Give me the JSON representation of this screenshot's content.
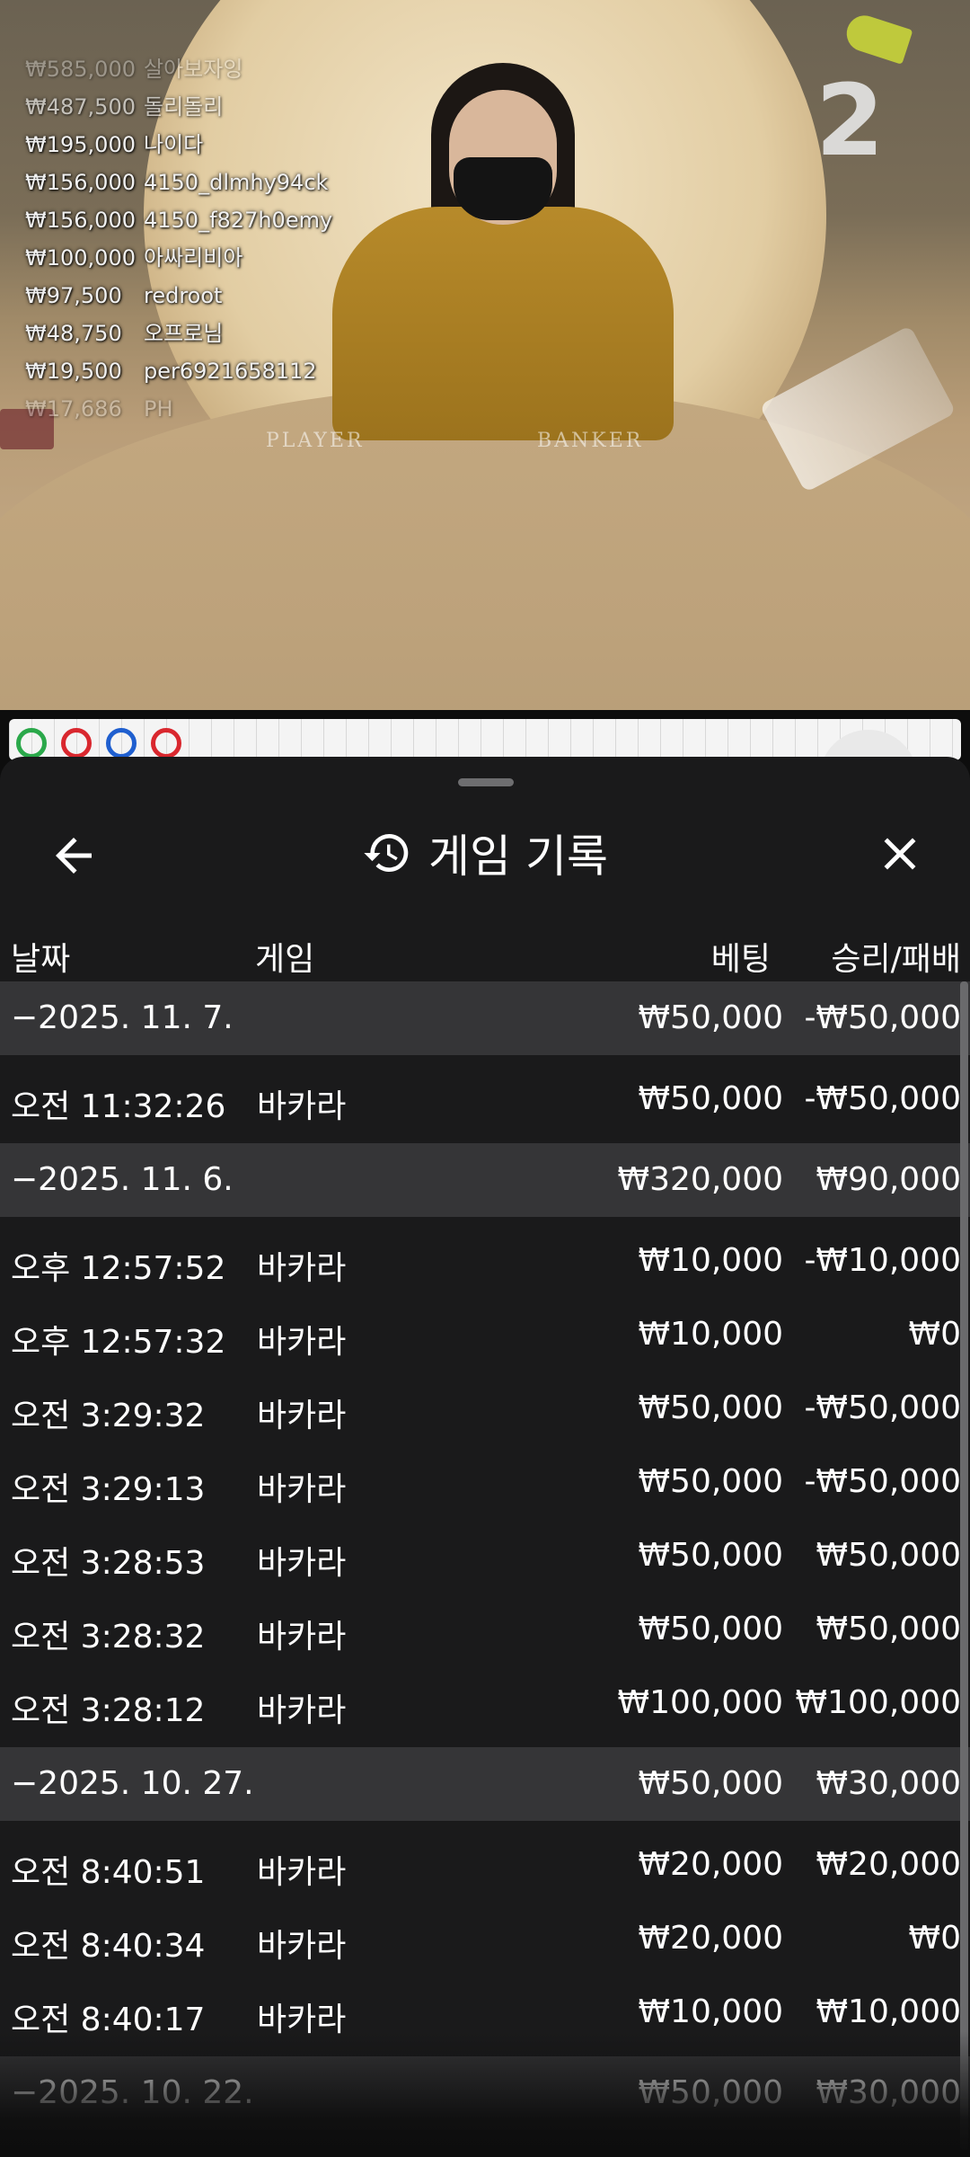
{
  "stream": {
    "round_number": "2",
    "table_labels": {
      "player": "PLAYER",
      "banker": "BANKER"
    },
    "winners": [
      {
        "amount": "₩585,000",
        "name": "살아보자잉",
        "style": "faded"
      },
      {
        "amount": "₩487,500",
        "name": "돌리돌리",
        "style": "dim"
      },
      {
        "amount": "₩195,000",
        "name": "나이다",
        "style": ""
      },
      {
        "amount": "₩156,000",
        "name": "4150_dlmhy94ck",
        "style": ""
      },
      {
        "amount": "₩156,000",
        "name": "4150_f827h0emy",
        "style": ""
      },
      {
        "amount": "₩100,000",
        "name": "아싸리비아",
        "style": ""
      },
      {
        "amount": "₩97,500",
        "name": "redroot",
        "style": ""
      },
      {
        "amount": "₩48,750",
        "name": "오프로님",
        "style": ""
      },
      {
        "amount": "₩19,500",
        "name": "per6921658112",
        "style": ""
      },
      {
        "amount": "₩17,686",
        "name": "PH",
        "style": "faded"
      }
    ],
    "roadmap_colors": {
      "green": "#2aa84a",
      "red": "#d9272e",
      "blue": "#1f5fcf"
    }
  },
  "sheet": {
    "title": "게임 기록",
    "icons": {
      "back": "arrow-left-icon",
      "history": "history-icon",
      "close": "close-icon"
    },
    "columns": {
      "date": "날짜",
      "game": "게임",
      "bet": "베팅",
      "win_loss": "승리/패배"
    },
    "rows": [
      {
        "type": "group",
        "date": "−2025. 11. 7.",
        "game": "",
        "bet": "₩50,000",
        "win": "-₩50,000"
      },
      {
        "type": "item",
        "date": "오전 11:32:26",
        "game": "바카라",
        "bet": "₩50,000",
        "win": "-₩50,000"
      },
      {
        "type": "group",
        "date": "−2025. 11. 6.",
        "game": "",
        "bet": "₩320,000",
        "win": "₩90,000"
      },
      {
        "type": "item",
        "date": "오후 12:57:52",
        "game": "바카라",
        "bet": "₩10,000",
        "win": "-₩10,000"
      },
      {
        "type": "item",
        "date": "오후 12:57:32",
        "game": "바카라",
        "bet": "₩10,000",
        "win": "₩0"
      },
      {
        "type": "item",
        "date": "오전 3:29:32",
        "game": "바카라",
        "bet": "₩50,000",
        "win": "-₩50,000"
      },
      {
        "type": "item",
        "date": "오전 3:29:13",
        "game": "바카라",
        "bet": "₩50,000",
        "win": "-₩50,000"
      },
      {
        "type": "item",
        "date": "오전 3:28:53",
        "game": "바카라",
        "bet": "₩50,000",
        "win": "₩50,000"
      },
      {
        "type": "item",
        "date": "오전 3:28:32",
        "game": "바카라",
        "bet": "₩50,000",
        "win": "₩50,000"
      },
      {
        "type": "item",
        "date": "오전 3:28:12",
        "game": "바카라",
        "bet": "₩100,000",
        "win": "₩100,000"
      },
      {
        "type": "group",
        "date": "−2025. 10. 27.",
        "game": "",
        "bet": "₩50,000",
        "win": "₩30,000"
      },
      {
        "type": "item",
        "date": "오전 8:40:51",
        "game": "바카라",
        "bet": "₩20,000",
        "win": "₩20,000"
      },
      {
        "type": "item",
        "date": "오전 8:40:34",
        "game": "바카라",
        "bet": "₩20,000",
        "win": "₩0"
      },
      {
        "type": "item",
        "date": "오전 8:40:17",
        "game": "바카라",
        "bet": "₩10,000",
        "win": "₩10,000"
      },
      {
        "type": "group",
        "date": "−2025. 10. 22.",
        "game": "",
        "bet": "₩50,000",
        "win": "₩30,000"
      }
    ]
  }
}
